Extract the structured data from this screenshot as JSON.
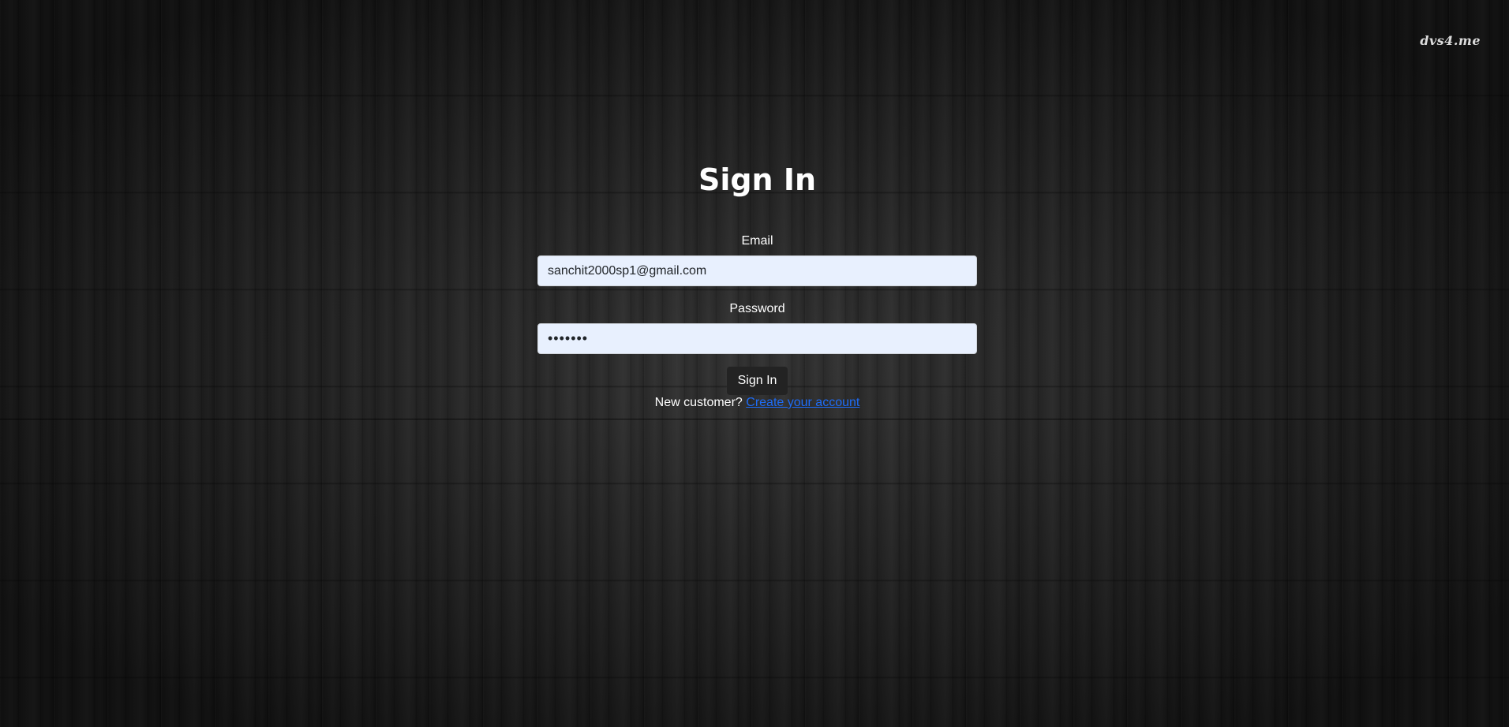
{
  "watermark": {
    "text": "dvs4.me"
  },
  "page": {
    "title": "Sign In"
  },
  "form": {
    "email_label": "Email",
    "email_value": "sanchit2000sp1@gmail.com",
    "password_label": "Password",
    "password_value": "•••••••",
    "submit_label": "Sign In"
  },
  "footer": {
    "prompt_text": "New customer?",
    "create_account_link": "Create your account"
  },
  "colors": {
    "link": "#1e6cf6",
    "input_bg": "#e8f0fe",
    "button_bg": "#232323"
  }
}
